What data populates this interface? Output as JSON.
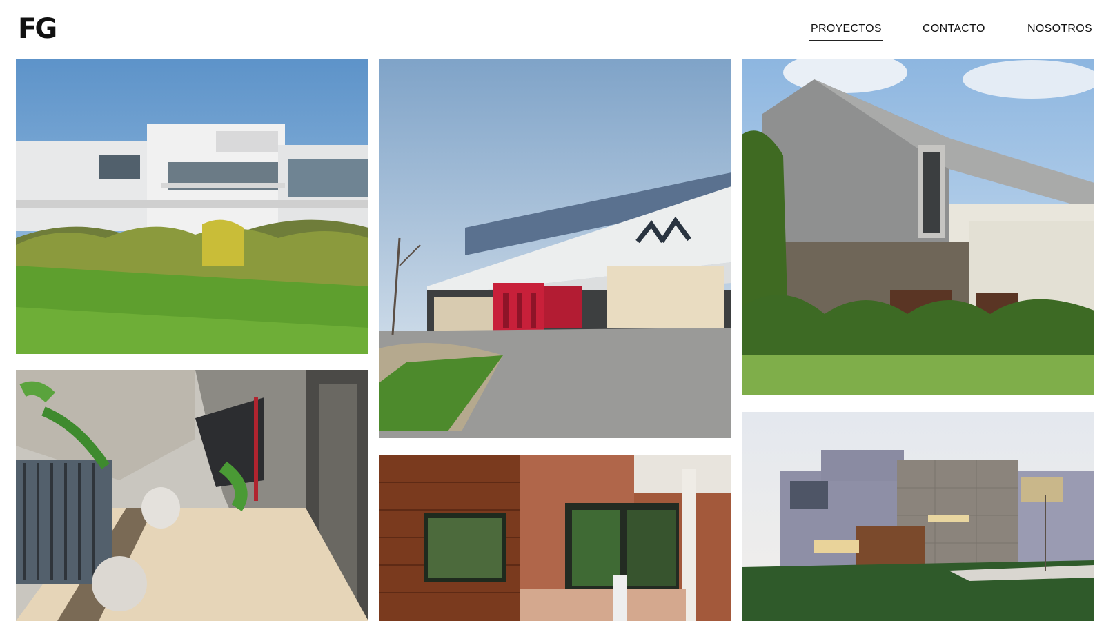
{
  "header": {
    "logo_text": "FG",
    "nav": {
      "proyectos": "PROYECTOS",
      "contacto": "CONTACTO",
      "nosotros": "NOSOTROS"
    },
    "active_item": "PROYECTOS"
  },
  "gallery": {
    "images": [
      {
        "subject": "white modern two-storey house above green lawn and shrubs"
      },
      {
        "subject": "industrial building with concrete facade, red entrance and arrow logo, gravel yard"
      },
      {
        "subject": "contemporary house with grey cladding box, stone wall and hedges"
      },
      {
        "subject": "covered corridor with tiled floor, potted plants and elevator doors"
      },
      {
        "subject": "brick and wood facade with dark framed windows"
      },
      {
        "subject": "modern white and stone house at dusk with lawn"
      }
    ]
  },
  "colors": {
    "text": "#111111",
    "background": "#ffffff",
    "accent_red": "#c8203a"
  }
}
